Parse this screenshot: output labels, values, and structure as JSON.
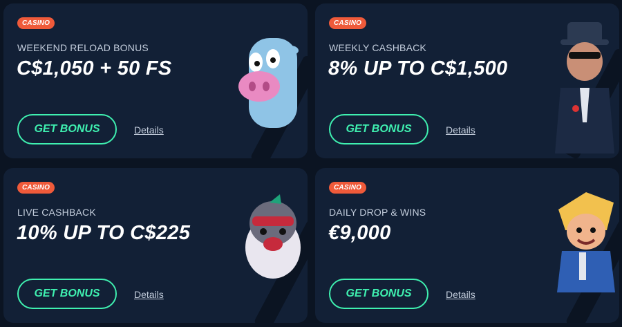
{
  "cards": [
    {
      "badge": "CASINO",
      "subtitle": "WEEKEND RELOAD BONUS",
      "amount": "C$1,050 + 50 FS",
      "button": "GET BONUS",
      "link": "Details",
      "art": "cow-character"
    },
    {
      "badge": "CASINO",
      "subtitle": "WEEKLY CASHBACK",
      "amount": "8% UP TO C$1,500",
      "button": "GET BONUS",
      "link": "Details",
      "art": "gangster-character"
    },
    {
      "badge": "CASINO",
      "subtitle": "LIVE CASHBACK",
      "amount": "10% UP TO C$225",
      "button": "GET BONUS",
      "link": "Details",
      "art": "hamster-character"
    },
    {
      "badge": "CASINO",
      "subtitle": "DAILY DROP & WINS",
      "amount": "€9,000",
      "button": "GET BONUS",
      "link": "Details",
      "art": "blonde-hero-character"
    }
  ],
  "colors": {
    "background": "#0b1422",
    "card": "#122036",
    "badge": "#ef5a3a",
    "accent": "#3ff0b0",
    "text": "#ffffff",
    "muted": "#c4cedd"
  }
}
